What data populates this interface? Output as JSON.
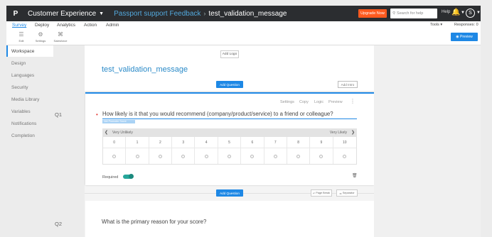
{
  "topbar": {
    "logo": "P",
    "product": "Customer Experience",
    "breadcrumb_link": "Passport support Feedback",
    "breadcrumb_sep": "›",
    "survey_name": "test_validation_message",
    "upgrade_label": "Upgrade Now",
    "search_placeholder": "Search for help",
    "help_label": "Help",
    "avatar_initial": "S"
  },
  "nav": {
    "survey": "Survey",
    "deploy": "Deploy",
    "analytics": "Analytics",
    "action": "Action",
    "admin": "Admin",
    "tools": "Tools ▾",
    "responses": "Responses: 0"
  },
  "toolbar": {
    "edit": "Edit",
    "settings": "Settings",
    "salesforce": "Salesforce",
    "preview": "Preview"
  },
  "sidebar": {
    "items": [
      {
        "label": "Workspace",
        "active": true
      },
      {
        "label": "Design",
        "active": false
      },
      {
        "label": "Languages",
        "active": false
      },
      {
        "label": "Security",
        "active": false
      },
      {
        "label": "Media Library",
        "active": false
      },
      {
        "label": "Variables",
        "active": false
      },
      {
        "label": "Notifications",
        "active": false
      },
      {
        "label": "Completion",
        "active": false
      }
    ]
  },
  "canvas": {
    "add_logo": "Add Logo",
    "title": "test_validation_message",
    "add_question": "Add Question",
    "add_intro": "Add Intro",
    "page_break": "Page Break",
    "separator": "Separator"
  },
  "q1": {
    "number": "Q1",
    "toolbar": {
      "settings": "Settings",
      "copy": "Copy",
      "logic": "Logic",
      "preview": "Preview",
      "more": "⋮"
    },
    "text": "How likely is it that you would recommend (company/product/service) to a friend or colleague?",
    "tag": "Net Promoter Score",
    "scale": {
      "left_label": "Very Unlikely",
      "right_label": "Very Likely",
      "options": [
        "0",
        "1",
        "2",
        "3",
        "4",
        "5",
        "6",
        "7",
        "8",
        "9",
        "10"
      ]
    },
    "required_label": "Required",
    "required_on": true
  },
  "q2": {
    "number": "Q2",
    "text": "What is the primary reason for your score?"
  },
  "colors": {
    "topbar": "#2b2d30",
    "accent": "#1e88e5",
    "upgrade": "#ff5a1f",
    "toggle": "#26a69a"
  },
  "icons": {
    "search": "search-icon",
    "bell": "bell-icon",
    "edit": "edit-icon",
    "settings": "gear-icon",
    "salesforce": "salesforce-icon",
    "trash": "trash-icon"
  }
}
